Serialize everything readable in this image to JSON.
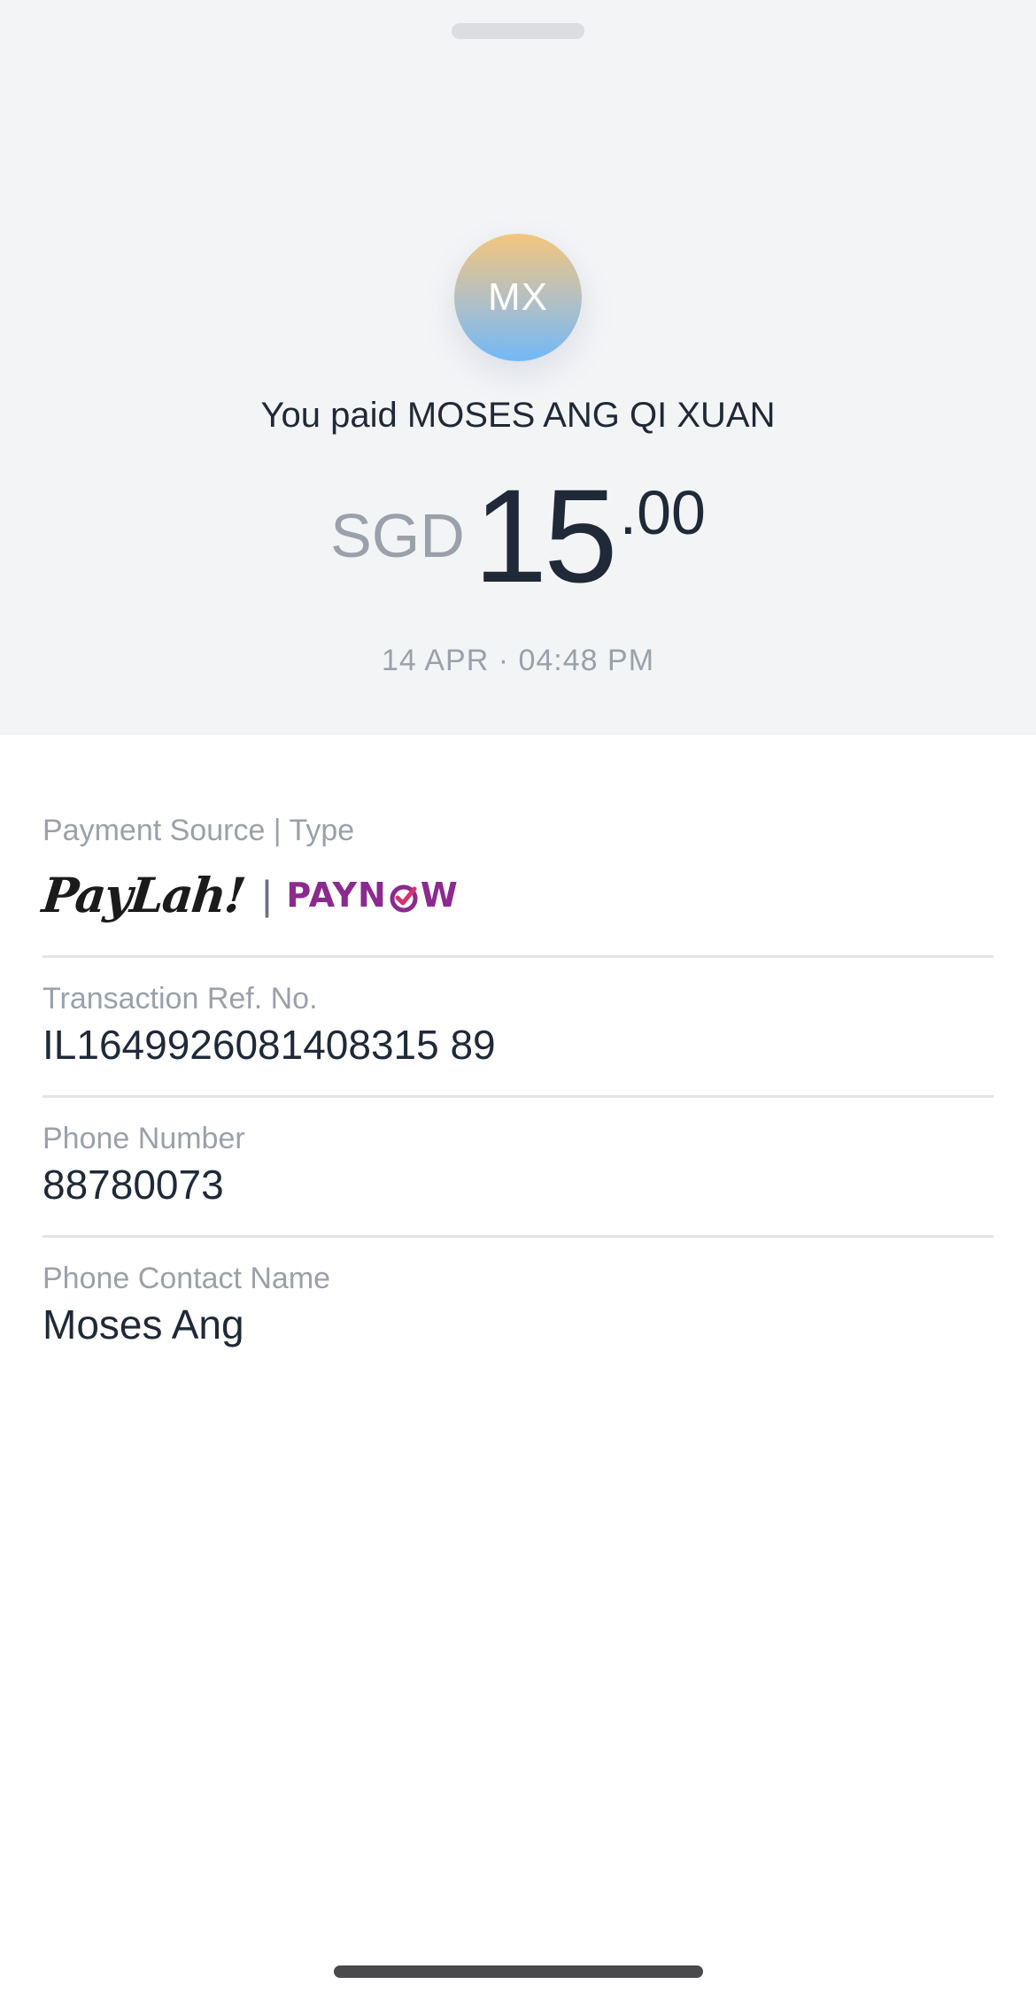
{
  "header": {
    "avatar_initials": "MX",
    "title": "You paid MOSES ANG QI XUAN",
    "amount": {
      "currency": "SGD",
      "whole": "15",
      "cents": ".00"
    },
    "datetime": "14 APR · 04:48 PM"
  },
  "details": {
    "payment_source": {
      "label": "Payment Source | Type",
      "paylah_logo_text": "PayLah!",
      "separator": "|",
      "paynow_logo_text": "PAYNOW"
    },
    "transaction_ref": {
      "label": "Transaction Ref. No.",
      "value": "IL1649926081408315 89"
    },
    "phone_number": {
      "label": "Phone Number",
      "value": "88780073"
    },
    "contact_name": {
      "label": "Phone Contact Name",
      "value": "Moses Ang"
    }
  },
  "colors": {
    "header_bg": "#f3f4f6",
    "text_primary": "#1f2937",
    "text_muted": "#9aa1aa",
    "paynow_purple": "#8b2a8f",
    "paynow_check": "#d6336c"
  }
}
